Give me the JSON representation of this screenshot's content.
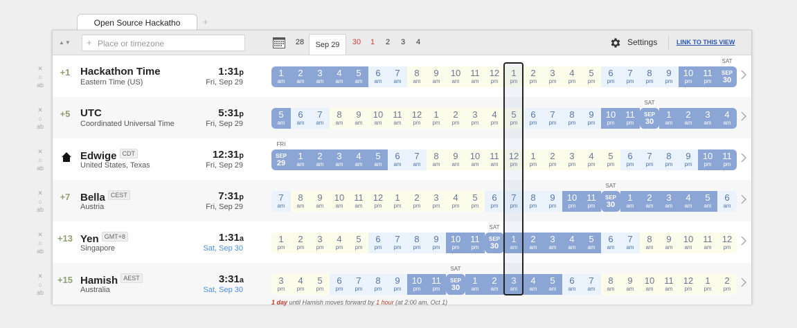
{
  "tab": {
    "title": "Open Source Hackatho",
    "add": "+"
  },
  "toolbar": {
    "search_placeholder": "Place or timezone",
    "dates": [
      {
        "label": "28",
        "active": false,
        "red": false
      },
      {
        "label": "Sep 29",
        "active": true,
        "red": false
      },
      {
        "label": "30",
        "active": false,
        "red": true
      },
      {
        "label": "1",
        "active": false,
        "red": true
      },
      {
        "label": "2",
        "active": false,
        "red": false
      },
      {
        "label": "3",
        "active": false,
        "red": false
      },
      {
        "label": "4",
        "active": false,
        "red": false
      }
    ],
    "settings": "Settings",
    "link": "LINK TO THIS VIEW"
  },
  "rows": [
    {
      "offset": "+1",
      "home": false,
      "name": "Hackathon Time",
      "badge": "",
      "subtitle": "Eastern Time (US)",
      "time": "1:31",
      "ampm": "p",
      "date": "Fri, Sep 29",
      "date_blue": false,
      "cells": [
        [
          "1",
          "am",
          "n"
        ],
        [
          "2",
          "am",
          "n"
        ],
        [
          "3",
          "am",
          "n"
        ],
        [
          "4",
          "am",
          "n"
        ],
        [
          "5",
          "am",
          "n"
        ],
        [
          "6",
          "am",
          "m"
        ],
        [
          "7",
          "am",
          "m"
        ],
        [
          "8",
          "am",
          "d"
        ],
        [
          "9",
          "am",
          "d"
        ],
        [
          "10",
          "am",
          "d"
        ],
        [
          "11",
          "am",
          "d"
        ],
        [
          "12",
          "pm",
          "d"
        ],
        [
          "1",
          "pm",
          "d"
        ],
        [
          "2",
          "pm",
          "d"
        ],
        [
          "3",
          "pm",
          "d"
        ],
        [
          "4",
          "pm",
          "d"
        ],
        [
          "5",
          "pm",
          "d"
        ],
        [
          "6",
          "pm",
          "m"
        ],
        [
          "7",
          "pm",
          "m"
        ],
        [
          "8",
          "pm",
          "m"
        ],
        [
          "9",
          "pm",
          "m"
        ],
        [
          "10",
          "pm",
          "n"
        ],
        [
          "11",
          "pm",
          "n"
        ],
        [
          "SEP",
          "30",
          "dc"
        ]
      ],
      "dayhd": "SAT",
      "dayhd_index": 23
    },
    {
      "offset": "+5",
      "home": false,
      "name": "UTC",
      "badge": "",
      "subtitle": "Coordinated Universal Time",
      "time": "5:31",
      "ampm": "p",
      "date": "Fri, Sep 29",
      "date_blue": false,
      "cells": [
        [
          "5",
          "am",
          "n"
        ],
        [
          "6",
          "am",
          "m"
        ],
        [
          "7",
          "am",
          "m"
        ],
        [
          "8",
          "am",
          "d"
        ],
        [
          "9",
          "am",
          "d"
        ],
        [
          "10",
          "am",
          "d"
        ],
        [
          "11",
          "am",
          "d"
        ],
        [
          "12",
          "pm",
          "d"
        ],
        [
          "1",
          "pm",
          "d"
        ],
        [
          "2",
          "pm",
          "d"
        ],
        [
          "3",
          "pm",
          "d"
        ],
        [
          "4",
          "pm",
          "d"
        ],
        [
          "5",
          "pm",
          "d"
        ],
        [
          "6",
          "pm",
          "m"
        ],
        [
          "7",
          "pm",
          "m"
        ],
        [
          "8",
          "pm",
          "m"
        ],
        [
          "9",
          "pm",
          "m"
        ],
        [
          "10",
          "pm",
          "n"
        ],
        [
          "11",
          "pm",
          "n"
        ],
        [
          "SEP",
          "30",
          "dc"
        ],
        [
          "1",
          "am",
          "n"
        ],
        [
          "2",
          "am",
          "n"
        ],
        [
          "3",
          "am",
          "n"
        ],
        [
          "4",
          "am",
          "n"
        ]
      ],
      "dayhd": "SAT",
      "dayhd_index": 19
    },
    {
      "offset": "",
      "home": true,
      "name": "Edwige",
      "badge": "CDT",
      "subtitle": "United States, Texas",
      "time": "12:31",
      "ampm": "p",
      "date": "Fri, Sep 29",
      "date_blue": false,
      "cells": [
        [
          "SEP",
          "29",
          "dc"
        ],
        [
          "1",
          "am",
          "n"
        ],
        [
          "2",
          "am",
          "n"
        ],
        [
          "3",
          "am",
          "n"
        ],
        [
          "4",
          "am",
          "n"
        ],
        [
          "5",
          "am",
          "n"
        ],
        [
          "6",
          "am",
          "m"
        ],
        [
          "7",
          "am",
          "m"
        ],
        [
          "8",
          "am",
          "d"
        ],
        [
          "9",
          "am",
          "d"
        ],
        [
          "10",
          "am",
          "d"
        ],
        [
          "11",
          "am",
          "d"
        ],
        [
          "12",
          "pm",
          "d"
        ],
        [
          "1",
          "pm",
          "d"
        ],
        [
          "2",
          "pm",
          "d"
        ],
        [
          "3",
          "pm",
          "d"
        ],
        [
          "4",
          "pm",
          "d"
        ],
        [
          "5",
          "pm",
          "d"
        ],
        [
          "6",
          "pm",
          "m"
        ],
        [
          "7",
          "pm",
          "m"
        ],
        [
          "8",
          "pm",
          "m"
        ],
        [
          "9",
          "pm",
          "m"
        ],
        [
          "10",
          "pm",
          "n"
        ],
        [
          "11",
          "pm",
          "n"
        ]
      ],
      "dayhd": "FRI",
      "dayhd_index": 0
    },
    {
      "offset": "+7",
      "home": false,
      "name": "Bella",
      "badge": "CEST",
      "subtitle": "Austria",
      "time": "7:31",
      "ampm": "p",
      "date": "Fri, Sep 29",
      "date_blue": false,
      "cells": [
        [
          "7",
          "am",
          "m"
        ],
        [
          "8",
          "am",
          "d"
        ],
        [
          "9",
          "am",
          "d"
        ],
        [
          "10",
          "am",
          "d"
        ],
        [
          "11",
          "am",
          "d"
        ],
        [
          "12",
          "pm",
          "d"
        ],
        [
          "1",
          "pm",
          "d"
        ],
        [
          "2",
          "pm",
          "d"
        ],
        [
          "3",
          "pm",
          "d"
        ],
        [
          "4",
          "pm",
          "d"
        ],
        [
          "5",
          "pm",
          "d"
        ],
        [
          "6",
          "pm",
          "m"
        ],
        [
          "7",
          "pm",
          "m"
        ],
        [
          "8",
          "pm",
          "m"
        ],
        [
          "9",
          "pm",
          "m"
        ],
        [
          "10",
          "pm",
          "n"
        ],
        [
          "11",
          "pm",
          "n"
        ],
        [
          "SEP",
          "30",
          "dc"
        ],
        [
          "1",
          "am",
          "n"
        ],
        [
          "2",
          "am",
          "n"
        ],
        [
          "3",
          "am",
          "n"
        ],
        [
          "4",
          "am",
          "n"
        ],
        [
          "5",
          "am",
          "n"
        ],
        [
          "6",
          "am",
          "m"
        ]
      ],
      "dayhd": "SAT",
      "dayhd_index": 17
    },
    {
      "offset": "+13",
      "home": false,
      "name": "Yen",
      "badge": "GMT+8",
      "subtitle": "Singapore",
      "time": "1:31",
      "ampm": "a",
      "date": "Sat, Sep 30",
      "date_blue": true,
      "cells": [
        [
          "1",
          "pm",
          "d"
        ],
        [
          "2",
          "pm",
          "d"
        ],
        [
          "3",
          "pm",
          "d"
        ],
        [
          "4",
          "pm",
          "d"
        ],
        [
          "5",
          "pm",
          "d"
        ],
        [
          "6",
          "pm",
          "m"
        ],
        [
          "7",
          "pm",
          "m"
        ],
        [
          "8",
          "pm",
          "m"
        ],
        [
          "9",
          "pm",
          "m"
        ],
        [
          "10",
          "pm",
          "n"
        ],
        [
          "11",
          "pm",
          "n"
        ],
        [
          "SEP",
          "30",
          "dc"
        ],
        [
          "1",
          "am",
          "n"
        ],
        [
          "2",
          "am",
          "n"
        ],
        [
          "3",
          "am",
          "n"
        ],
        [
          "4",
          "am",
          "n"
        ],
        [
          "5",
          "am",
          "n"
        ],
        [
          "6",
          "am",
          "m"
        ],
        [
          "7",
          "am",
          "m"
        ],
        [
          "8",
          "am",
          "d"
        ],
        [
          "9",
          "am",
          "d"
        ],
        [
          "10",
          "am",
          "d"
        ],
        [
          "11",
          "am",
          "d"
        ],
        [
          "12",
          "pm",
          "d"
        ]
      ],
      "dayhd": "SAT",
      "dayhd_index": 11
    },
    {
      "offset": "+15",
      "home": false,
      "name": "Hamish",
      "badge": "AEST",
      "subtitle": "Australia",
      "time": "3:31",
      "ampm": "a",
      "date": "Sat, Sep 30",
      "date_blue": true,
      "cells": [
        [
          "3",
          "pm",
          "d"
        ],
        [
          "4",
          "pm",
          "d"
        ],
        [
          "5",
          "pm",
          "d"
        ],
        [
          "6",
          "pm",
          "m"
        ],
        [
          "7",
          "pm",
          "m"
        ],
        [
          "8",
          "pm",
          "m"
        ],
        [
          "9",
          "pm",
          "m"
        ],
        [
          "10",
          "pm",
          "n"
        ],
        [
          "11",
          "pm",
          "n"
        ],
        [
          "SEP",
          "30",
          "dc"
        ],
        [
          "1",
          "am",
          "n"
        ],
        [
          "2",
          "am",
          "n"
        ],
        [
          "3",
          "am",
          "n"
        ],
        [
          "4",
          "am",
          "n"
        ],
        [
          "5",
          "am",
          "n"
        ],
        [
          "6",
          "am",
          "m"
        ],
        [
          "7",
          "am",
          "m"
        ],
        [
          "8",
          "am",
          "d"
        ],
        [
          "9",
          "am",
          "d"
        ],
        [
          "10",
          "am",
          "d"
        ],
        [
          "11",
          "am",
          "d"
        ],
        [
          "12",
          "pm",
          "d"
        ],
        [
          "1",
          "pm",
          "d"
        ],
        [
          "2",
          "pm",
          "d"
        ]
      ],
      "dayhd": "SAT",
      "dayhd_index": 9,
      "dst_days": "1 day",
      "dst_text": " until Hamish moves forward by ",
      "dst_hour": "1 hour",
      "dst_when": " (at 2:00 am, Oct 1)"
    }
  ],
  "colors": {
    "night": "#8ba5d4",
    "morning": "#eaf3fb",
    "day": "#fcfcea",
    "accent": "#8fa172",
    "link": "#2a56b0"
  },
  "icons": {
    "remove": "close-icon",
    "home": "home-icon",
    "settings": "gear-icon",
    "calendar": "calendar-icon",
    "next": "chevron-right-icon"
  }
}
